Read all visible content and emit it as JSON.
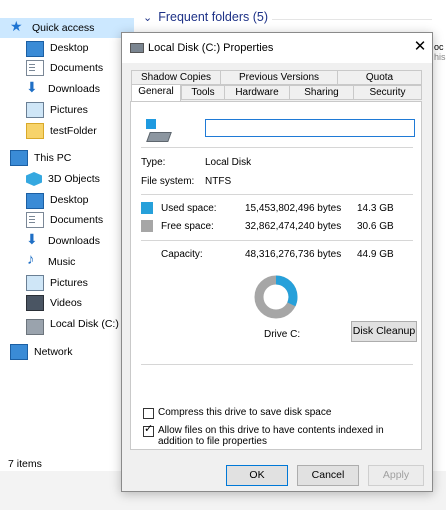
{
  "explorer": {
    "quick_access": "Quick access",
    "quick_items": [
      "Desktop",
      "Documents",
      "Downloads",
      "Pictures",
      "testFolder"
    ],
    "this_pc": "This PC",
    "pc_items": [
      "3D Objects",
      "Desktop",
      "Documents",
      "Downloads",
      "Music",
      "Pictures",
      "Videos",
      "Local Disk (C:)"
    ],
    "network": "Network",
    "status": "7 items",
    "frequent_header": "Frequent folders (5)",
    "edge_text_1": "oc",
    "edge_text_2": "his"
  },
  "dialog": {
    "title": "Local Disk (C:) Properties",
    "close": "✕",
    "tabs_row1": [
      "Shadow Copies",
      "Previous Versions",
      "Quota"
    ],
    "tabs_row2": [
      "General",
      "Tools",
      "Hardware",
      "Sharing",
      "Security"
    ],
    "active_tab": "General",
    "name_value": "",
    "type_label": "Type:",
    "type_value": "Local Disk",
    "fs_label": "File system:",
    "fs_value": "NTFS",
    "used_label": "Used space:",
    "used_bytes": "15,453,802,496 bytes",
    "used_gb": "14.3 GB",
    "free_label": "Free space:",
    "free_bytes": "32,862,474,240 bytes",
    "free_gb": "30.6 GB",
    "capacity_label": "Capacity:",
    "capacity_bytes": "48,316,276,736 bytes",
    "capacity_gb": "44.9 GB",
    "drive_label": "Drive C:",
    "disk_cleanup": "Disk Cleanup",
    "compress_label": "Compress this drive to save disk space",
    "compress_checked": false,
    "index_label": "Allow files on this drive to have contents indexed in addition to file properties",
    "index_checked": true,
    "ok": "OK",
    "cancel": "Cancel",
    "apply": "Apply",
    "used_fraction": 0.32,
    "used_color": "#26a0da",
    "free_color": "#a6a6a6"
  }
}
